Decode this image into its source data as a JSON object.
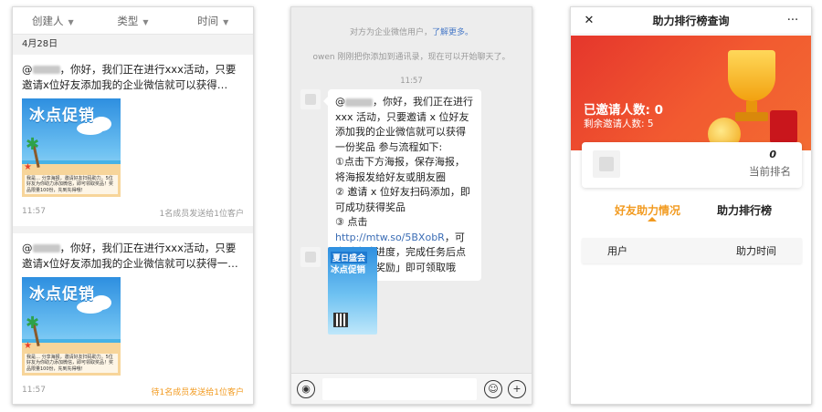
{
  "panel1": {
    "filters": [
      {
        "label": "创建人"
      },
      {
        "label": "类型"
      },
      {
        "label": "时间"
      }
    ],
    "date": "4月28日",
    "messages": [
      {
        "text_prefix": "@",
        "text": "，你好，我们正在进行xxx活动，只要邀请x位好友添加我的企业微信就可以获得…",
        "poster_title": "冰点促销",
        "poster_note": "我是… 分享海报，邀请好友扫码助力。5位好友为你助力添加微信，即可领取奖品！奖品限量100份，先到先得哦！",
        "time": "11:57",
        "status": "1名成员发送给1位客户",
        "status_highlight": false
      },
      {
        "text_prefix": "@",
        "text": "，你好，我们正在进行xxx活动，只要邀请x位好友添加我的企业微信就可以获得一…",
        "poster_title": "冰点促销",
        "poster_note": "我是… 分享海报，邀请好友扫码助力。5位好友为你助力添加微信，即可领取奖品！奖品限量100份，先到先得哦！",
        "time": "11:57",
        "status": "待1名成员发送给1位客户",
        "status_highlight": true
      }
    ]
  },
  "panel2": {
    "notice_text": "对方为企业微信用户，",
    "notice_link": "了解更多。",
    "notice2": "owen 刚刚把你添加到通讯录，现在可以开始聊天了。",
    "time": "11:57",
    "bubble": {
      "prefix": "@",
      "line1": "，你好，我们正在进行 xxx 活动，只要邀请 x 位好友添加我的企业微信就可以获得一份奖品 参与流程如下:",
      "step1": "①点击下方海报，保存海报，将海报发给好友或朋友圈",
      "step2": "② 邀请 x 位好友扫码添加，即可成功获得奖品",
      "step3_prefix": "③ 点击 ",
      "url": "http://mtw.so/5BXobR",
      "step3_suffix": "，可查看完成进度，完成任务后点击「领取奖励」即可领取哦"
    },
    "poster_sm_t1": "夏日盛会",
    "poster_sm_t2": "冰点促销"
  },
  "panel3": {
    "title": "助力排行榜查询",
    "close_icon": "✕",
    "more_icon": "···",
    "invited_label": "已邀请人数: 0",
    "remaining_label": "剩余邀请人数: 5",
    "rank_value": "0",
    "rank_label": "当前排名",
    "tab_active": "好友助力情况",
    "tab_inactive": "助力排行榜",
    "col_user": "用户",
    "col_time": "助力时间"
  },
  "colors": {
    "accent_orange": "#f29a1f",
    "banner_red": "#e5362c",
    "link_blue": "#4a7bc8"
  }
}
